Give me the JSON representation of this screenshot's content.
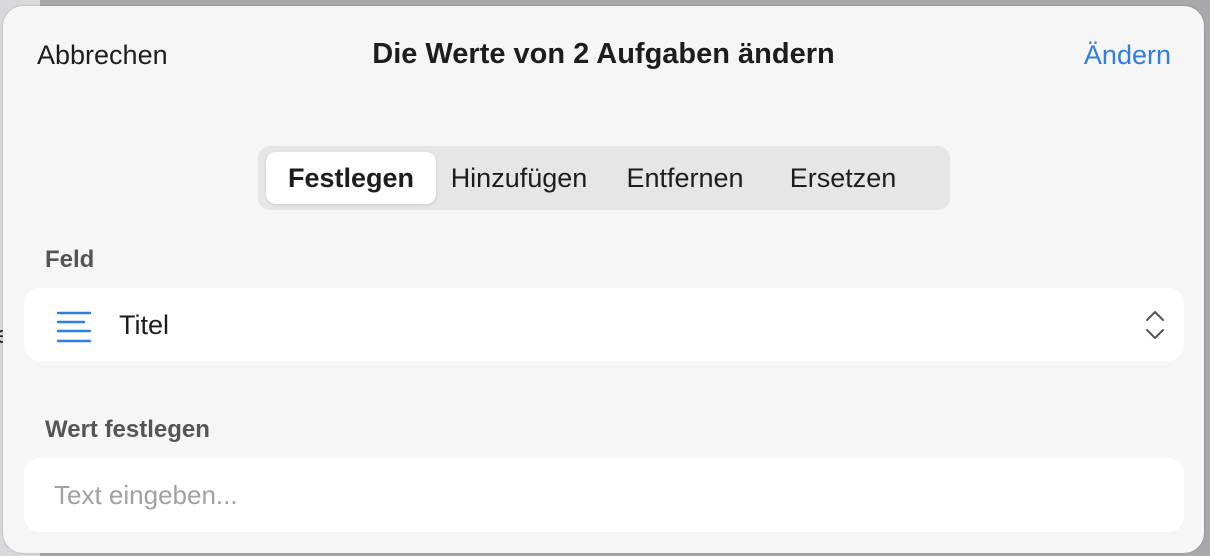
{
  "backdrop": {
    "partial_glyph": "e"
  },
  "dialog": {
    "cancel_label": "Abbrechen",
    "title": "Die Werte von 2 Aufgaben ändern",
    "apply_label": "Ändern"
  },
  "modes": {
    "selected": "Festlegen",
    "items": [
      {
        "label": "Festlegen"
      },
      {
        "label": "Hinzufügen"
      },
      {
        "label": "Entfernen"
      },
      {
        "label": "Ersetzen"
      }
    ]
  },
  "field_section": {
    "label": "Feld",
    "selected_value": "Titel",
    "icon": "text-lines-icon",
    "control_icon": "chevron-up-down-icon"
  },
  "value_section": {
    "label": "Wert festlegen",
    "input_value": "",
    "placeholder": "Text eingeben..."
  },
  "colors": {
    "accent": "#2f7de1",
    "sheet_background": "#f6f6f6",
    "segment_background": "#e6e6e7",
    "field_background": "#ffffff"
  }
}
